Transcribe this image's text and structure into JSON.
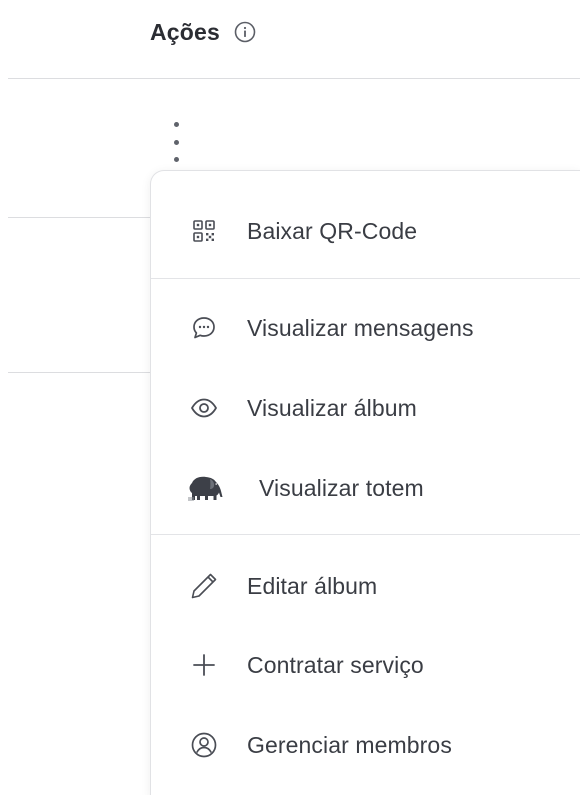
{
  "table": {
    "actions_header": "Ações",
    "info_icon": "info-icon",
    "row_menu_icon": "kebab-vertical-icon"
  },
  "menu": {
    "items": [
      {
        "label": "Baixar QR-Code",
        "icon": "qr-code-icon"
      },
      {
        "label": "Visualizar mensagens",
        "icon": "chat-bubble-icon"
      },
      {
        "label": "Visualizar álbum",
        "icon": "eye-icon"
      },
      {
        "label": "Visualizar totem",
        "icon": "elephant-icon"
      },
      {
        "label": "Editar álbum",
        "icon": "pencil-icon"
      },
      {
        "label": "Contratar serviço",
        "icon": "plus-icon"
      },
      {
        "label": "Gerenciar membros",
        "icon": "user-circle-icon"
      }
    ]
  },
  "colors": {
    "text": "#3a3d44",
    "icon": "#4a4d55",
    "divider": "#e3e4e7"
  }
}
